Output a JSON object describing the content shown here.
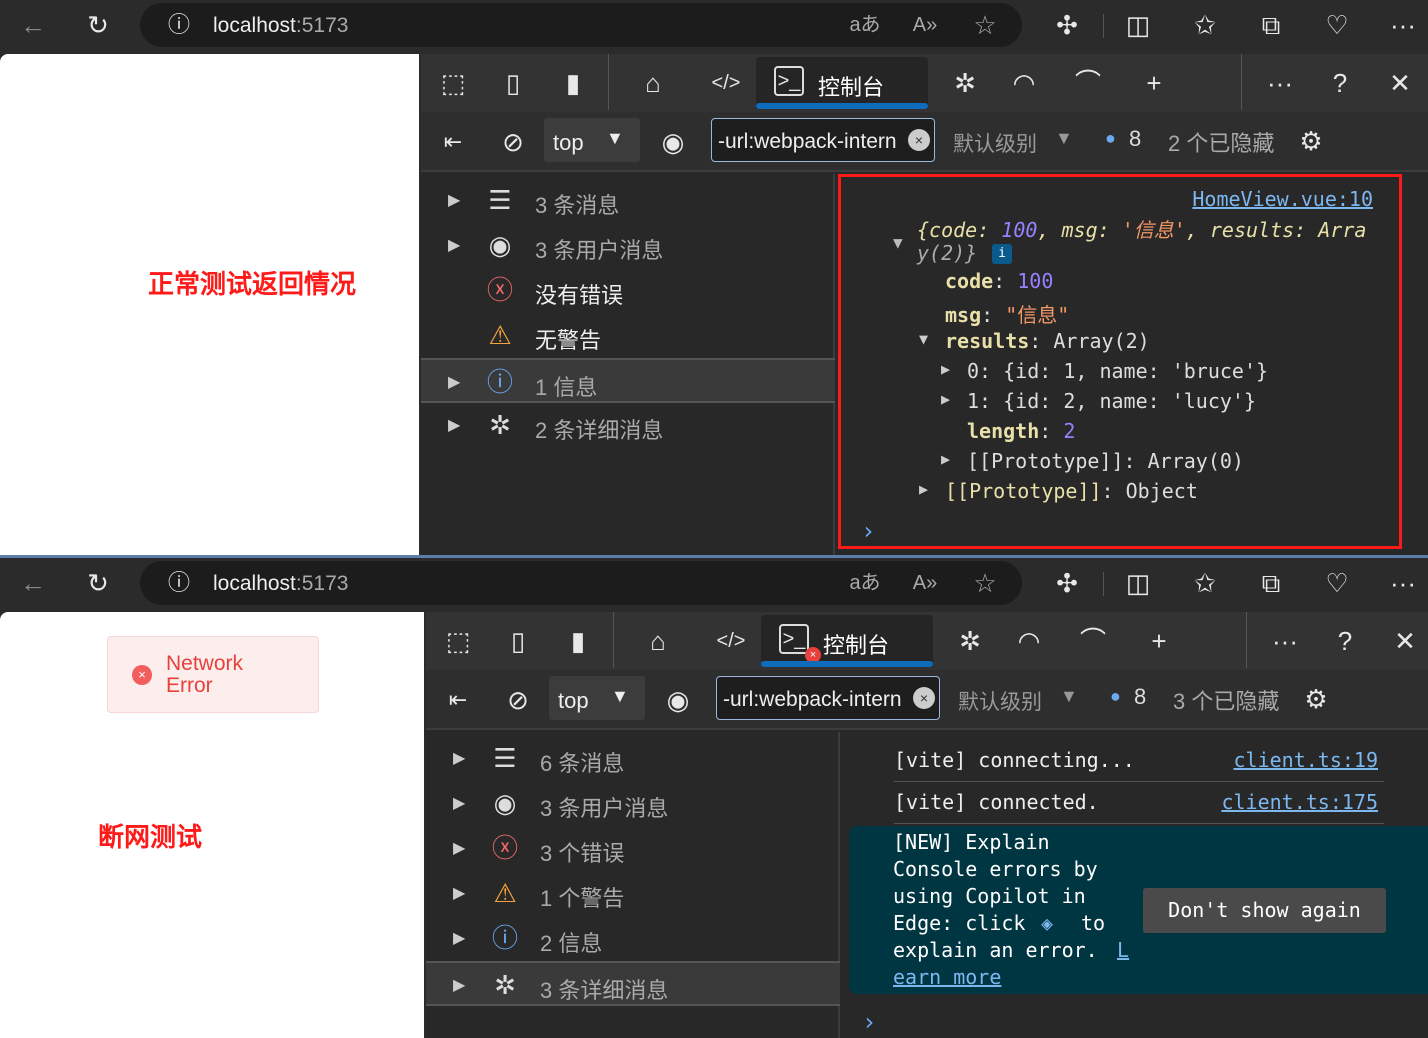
{
  "colors": {
    "accent": "#0f6cbd",
    "error": "#e8413c",
    "annotation": "#ff0000"
  },
  "windows": [
    {
      "address": "localhost",
      "port": ":5173",
      "page_annotation": "正常测试返回情况",
      "devtools": {
        "console_tab": "控制台",
        "context": "top",
        "filter_value": "-url:webpack-intern",
        "level": "默认级别",
        "message_count": "8",
        "hidden": "2 个已隐藏",
        "sidebar": [
          {
            "label": "3 条消息",
            "icon": "list-icon",
            "expand": true
          },
          {
            "label": "3 条用户消息",
            "icon": "user-icon",
            "expand": true
          },
          {
            "label": "没有错误",
            "icon": "error-icon",
            "expand": false
          },
          {
            "label": "无警告",
            "icon": "warning-icon",
            "expand": false
          },
          {
            "label": "1 信息",
            "icon": "info-icon",
            "expand": true,
            "selected": true
          },
          {
            "label": "2 条详细消息",
            "icon": "bug-icon",
            "expand": true
          }
        ]
      },
      "console": {
        "source": "HomeView.vue:10",
        "summary_1": "{code: ",
        "summary_code": "100",
        "summary_2": ", msg: ",
        "summary_msg": "'信息'",
        "summary_3": ", results: Arra",
        "summary_4": "y(2)}",
        "lines": [
          {
            "key": "code",
            "value": "100"
          },
          {
            "key": "msg",
            "value": "\"信息\""
          },
          {
            "key": "results",
            "value": "Array(2)"
          },
          {
            "key": "0",
            "value": "{id: 1, name: 'bruce'}"
          },
          {
            "key": "1",
            "value": "{id: 2, name: 'lucy'}"
          },
          {
            "key": "length",
            "value": "2"
          },
          {
            "key": "[[Prototype]]",
            "value": "Array(0)"
          },
          {
            "key": "[[Prototype]]",
            "value": "Object"
          }
        ]
      }
    },
    {
      "address": "localhost",
      "port": ":5173",
      "page_annotation": "断网测试",
      "toast": "Network Error",
      "devtools": {
        "console_tab": "控制台",
        "context": "top",
        "filter_value": "-url:webpack-intern",
        "level": "默认级别",
        "message_count": "8",
        "hidden": "3 个已隐藏",
        "sidebar": [
          {
            "label": "6 条消息",
            "icon": "list-icon",
            "expand": true
          },
          {
            "label": "3 条用户消息",
            "icon": "user-icon",
            "expand": true
          },
          {
            "label": "3 个错误",
            "icon": "error-icon",
            "expand": true
          },
          {
            "label": "1 个警告",
            "icon": "warning-icon",
            "expand": true
          },
          {
            "label": "2 信息",
            "icon": "info-icon",
            "expand": true
          },
          {
            "label": "3 条详细消息",
            "icon": "bug-icon",
            "expand": true,
            "selected": true
          }
        ]
      },
      "console": {
        "messages": [
          {
            "text": "[vite] connecting...",
            "source": "client.ts:19"
          },
          {
            "text": "[vite] connected.",
            "source": "client.ts:175"
          }
        ],
        "promo_lines": [
          "[NEW] Explain",
          "Console errors by",
          "using Copilot in",
          "Edge: click",
          " to",
          "explain an error. "
        ],
        "promo_link_1": "L",
        "promo_link_2": "earn more",
        "dismiss": "Don't show again"
      }
    }
  ]
}
